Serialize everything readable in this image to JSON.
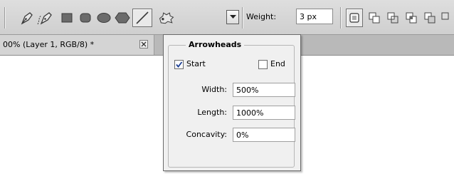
{
  "toolbar": {
    "tools": [
      {
        "name": "pen-tool-icon"
      },
      {
        "name": "freeform-pen-tool-icon"
      },
      {
        "name": "rectangle-tool-icon"
      },
      {
        "name": "rounded-rectangle-tool-icon"
      },
      {
        "name": "ellipse-tool-icon"
      },
      {
        "name": "polygon-tool-icon"
      },
      {
        "name": "line-tool-icon",
        "active": true
      },
      {
        "name": "custom-shape-tool-icon"
      }
    ],
    "dropdown_icon": "chevron-down-icon",
    "weight_label": "Weight:",
    "weight_value": "3 px",
    "path_ops_icons": [
      "add-to-shape-area-icon",
      "subtract-from-shape-area-icon",
      "intersect-shape-areas-icon",
      "exclude-overlapping-areas-icon"
    ]
  },
  "document_tab": {
    "title": "00% (Layer 1, RGB/8) *",
    "close_icon": "close-icon"
  },
  "arrowheads": {
    "title": "Arrowheads",
    "start_label": "Start",
    "start_checked": true,
    "end_label": "End",
    "end_checked": false,
    "width_label": "Width:",
    "width_value": "500%",
    "length_label": "Length:",
    "length_value": "1000%",
    "concavity_label": "Concavity:",
    "concavity_value": "0%"
  },
  "colors": {
    "toolbar_bg": "#d6d6d6",
    "panel_bg": "#f0f0f0",
    "check_color": "#1c3f94"
  }
}
